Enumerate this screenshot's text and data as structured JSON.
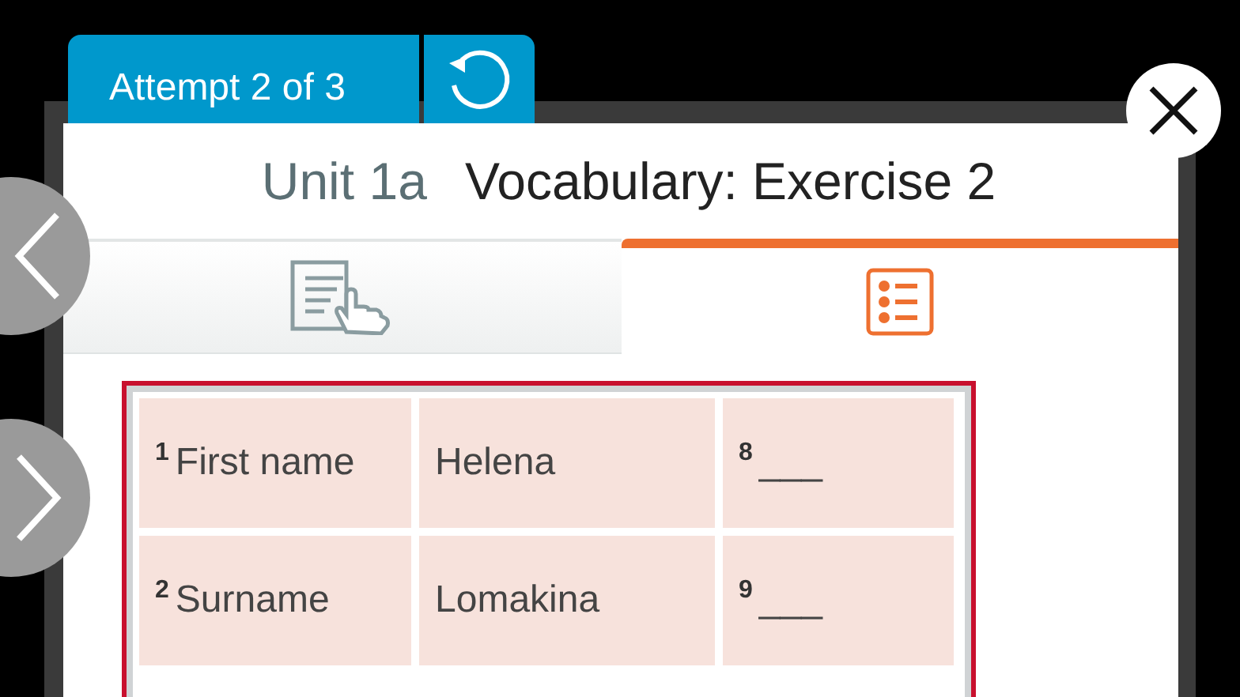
{
  "attempt": {
    "label": "Attempt 2 of 3"
  },
  "title": {
    "unit": "Unit 1a",
    "name": "Vocabulary: Exercise 2"
  },
  "tabs": [
    {
      "kind": "document",
      "selected": false
    },
    {
      "kind": "list",
      "selected": true
    }
  ],
  "table": {
    "rows": [
      {
        "cells": [
          {
            "number": "1",
            "text": "First name"
          },
          {
            "text": "Helena"
          },
          {
            "number": "8",
            "text": "___"
          }
        ]
      },
      {
        "cells": [
          {
            "number": "2",
            "text": "Surname"
          },
          {
            "text": "Lomakina"
          },
          {
            "number": "9",
            "text": "___"
          }
        ]
      }
    ]
  }
}
